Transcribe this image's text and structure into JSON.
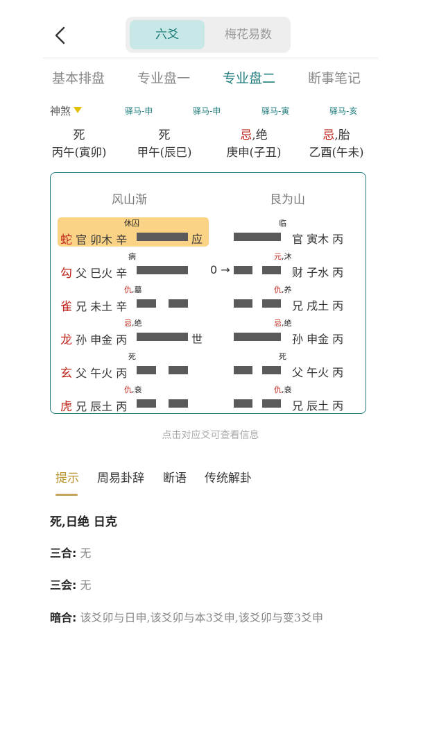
{
  "header": {
    "seg_tabs": [
      "六爻",
      "梅花易数"
    ]
  },
  "tabs": [
    "基本排盘",
    "专业盘一",
    "专业盘二",
    "断事笔记"
  ],
  "shensha": {
    "label": "神煞",
    "yima": [
      "驿马-申",
      "驿马-申",
      "驿马-寅",
      "驿马-亥"
    ]
  },
  "pillars": [
    {
      "ji": "",
      "state": "死",
      "gz": "丙午(寅卯)"
    },
    {
      "ji": "",
      "state": "死",
      "gz": "甲午(辰巳)"
    },
    {
      "ji": "忌",
      "state": ",绝",
      "gz": "庚申(子丑)"
    },
    {
      "ji": "忌",
      "state": ",胎",
      "gz": "乙酉(午未)"
    }
  ],
  "hexagram": {
    "left_name": "风山渐",
    "right_name": "艮为山",
    "lines": [
      {
        "lab_red": "",
        "lab": "休囚",
        "beast": "蛇",
        "text": "官 卯木 辛",
        "mark": "应",
        "rlab_red": "",
        "rlab": "临",
        "rtext": "官 寅木 丙",
        "arrow": ""
      },
      {
        "lab_red": "",
        "lab": "病",
        "beast": "勾",
        "text": "父 巳火 辛",
        "mark": "",
        "rlab_red": "元",
        "rlab": ",沐",
        "rtext": "财 子水 丙",
        "arrow": "0 →"
      },
      {
        "lab_red": "仇",
        "lab": ",墓",
        "beast": "雀",
        "text": "兄 未土 辛",
        "mark": "",
        "rlab_red": "仇",
        "rlab": ",养",
        "rtext": "兄 戌土 丙",
        "arrow": ""
      },
      {
        "lab_red": "忌",
        "lab": ",绝",
        "beast": "龙",
        "text": "孙 申金 丙",
        "mark": "世",
        "rlab_red": "忌",
        "rlab": ",绝",
        "rtext": "孙 申金 丙",
        "arrow": ""
      },
      {
        "lab_red": "",
        "lab": "死",
        "beast": "玄",
        "text": "父 午火 丙",
        "mark": "",
        "rlab_red": "",
        "rlab": "死",
        "rtext": "父 午火 丙",
        "arrow": ""
      },
      {
        "lab_red": "仇",
        "lab": ",衰",
        "beast": "虎",
        "text": "兄 辰土 丙",
        "mark": "",
        "rlab_red": "仇",
        "rlab": ",衰",
        "rtext": "兄 辰土 丙",
        "arrow": ""
      }
    ]
  },
  "hint": "点击对应爻可查看信息",
  "bottom_tabs": [
    "提示",
    "周易卦辞",
    "断语",
    "传统解卦"
  ],
  "summary": "死,日绝  日克",
  "info": [
    {
      "k": "三合:",
      "v": "无"
    },
    {
      "k": "三会:",
      "v": "无"
    },
    {
      "k": "暗合:",
      "v": "该爻卯与日申,该爻卯与本3爻申,该爻卯与变3爻申"
    }
  ],
  "colors": {
    "accent": "#1e7b7b",
    "red": "#c0261d",
    "gold": "#b8922a",
    "highlight": "#fbd387"
  }
}
